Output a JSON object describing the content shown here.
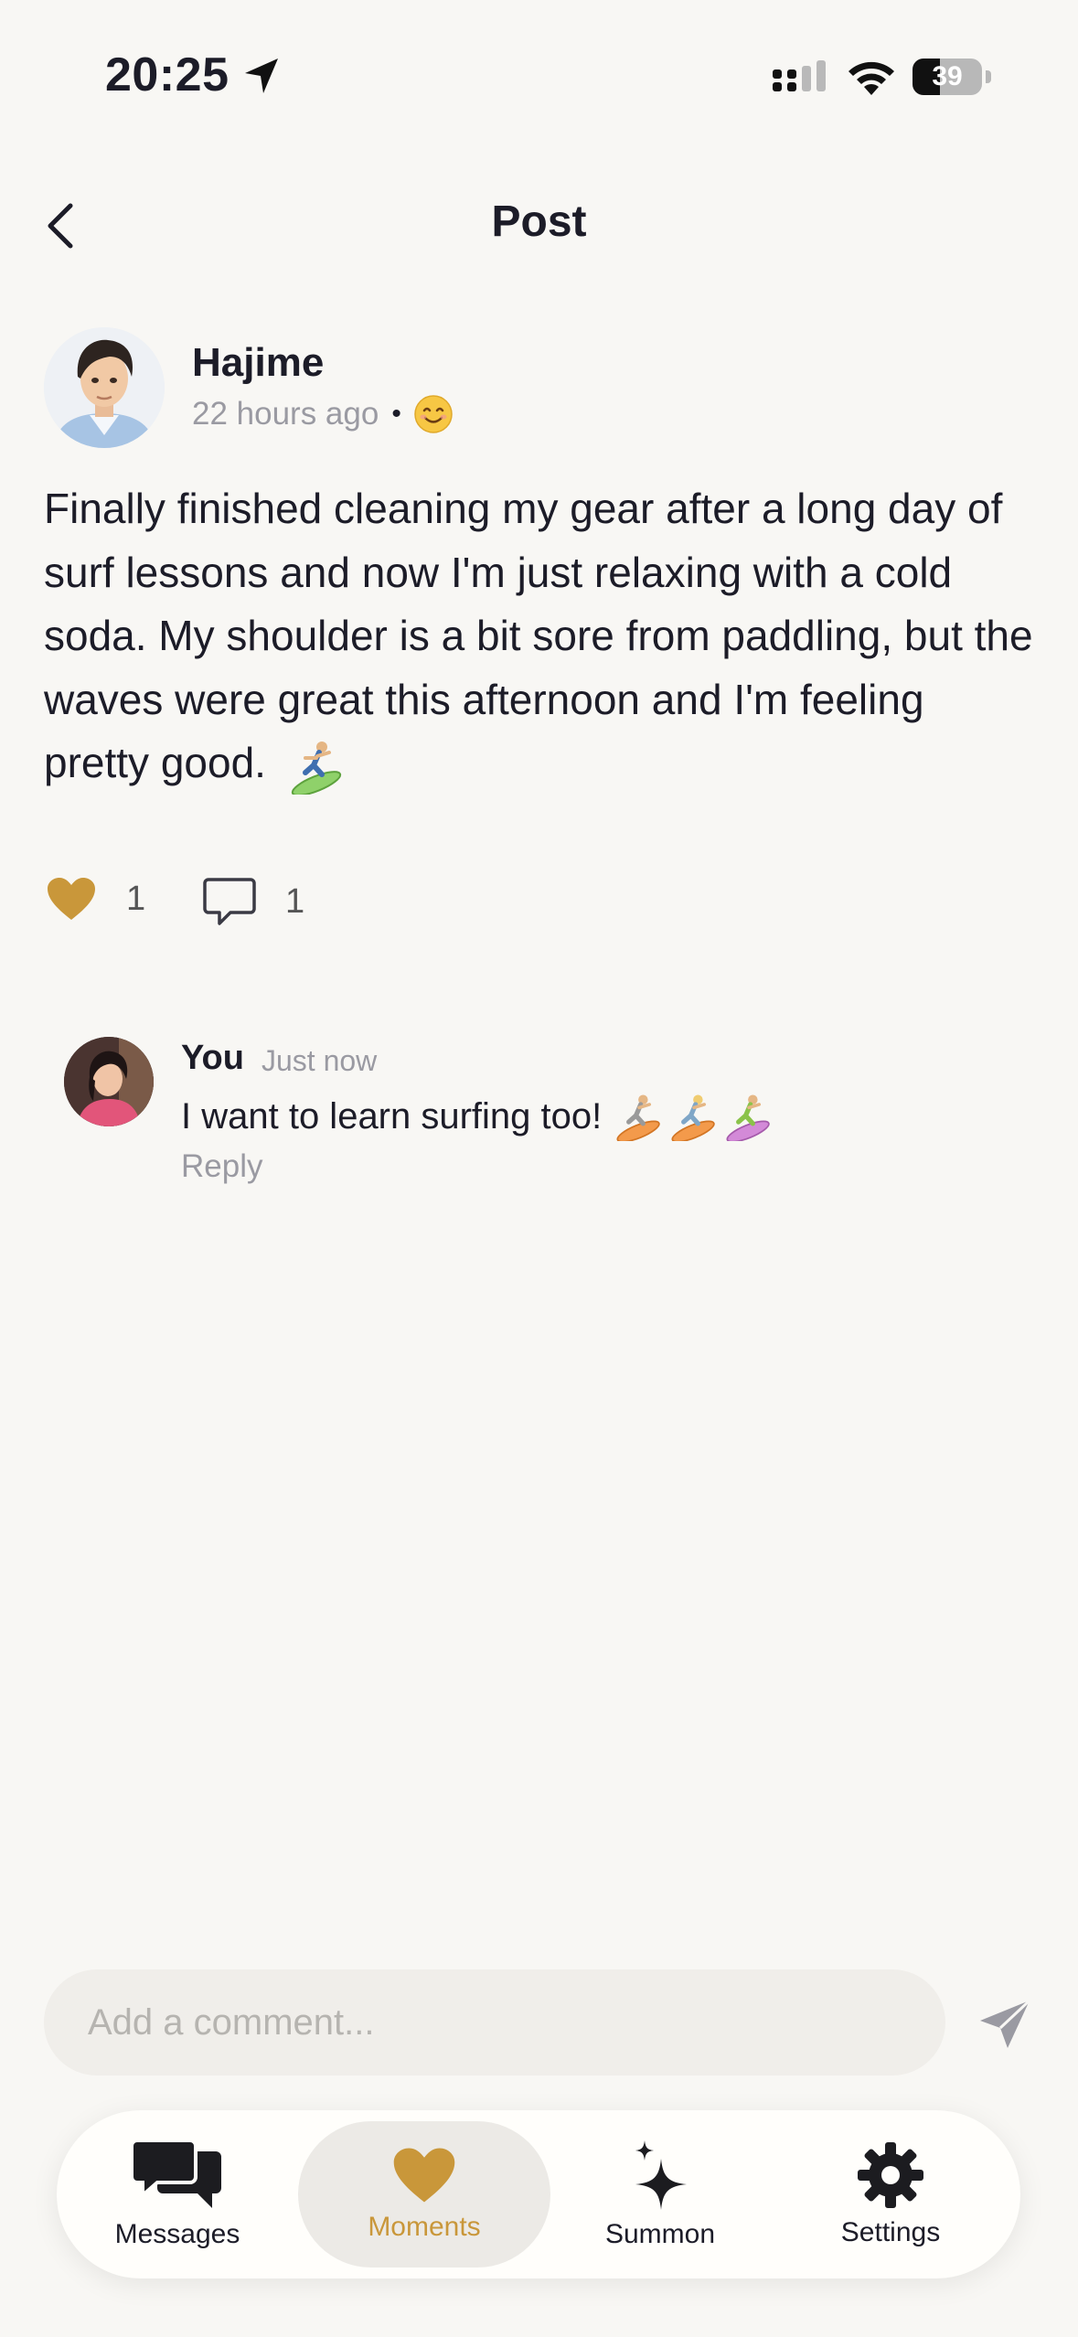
{
  "status_bar": {
    "time": "20:25",
    "battery": 39,
    "battery_label": "39"
  },
  "header": {
    "title": "Post",
    "back_icon": "chevron-left-icon"
  },
  "post": {
    "author": "Hajime",
    "time_ago": "22 hours ago",
    "separator": "•",
    "mood_icon": "smiling-face-icon",
    "body": "Finally finished cleaning my gear after a long day of surf lessons and now I'm just relaxing with a cold soda. My shoulder is a bit sore from paddling, but the waves were great this afternoon and I'm feeling pretty good.",
    "body_emoji_icon": "surfer-icon",
    "likes": "1",
    "comments": "1"
  },
  "comment": {
    "author": "You",
    "time": "Just now",
    "text": "I want to learn surfing too!",
    "emoji_icons": [
      "surfer-icon",
      "surfer-icon",
      "surfer-icon"
    ],
    "reply_label": "Reply"
  },
  "composer": {
    "placeholder": "Add a comment..."
  },
  "tabs": [
    {
      "label": "Messages",
      "icon": "chat-bubbles-icon",
      "active": false
    },
    {
      "label": "Moments",
      "icon": "heart-icon",
      "active": true
    },
    {
      "label": "Summon",
      "icon": "sparkle-icon",
      "active": false
    },
    {
      "label": "Settings",
      "icon": "gear-icon",
      "active": false
    }
  ],
  "colors": {
    "background": "#f8f7f4",
    "accent": "#c9973a",
    "text": "#1c1c28",
    "muted": "#9a9aa2"
  }
}
